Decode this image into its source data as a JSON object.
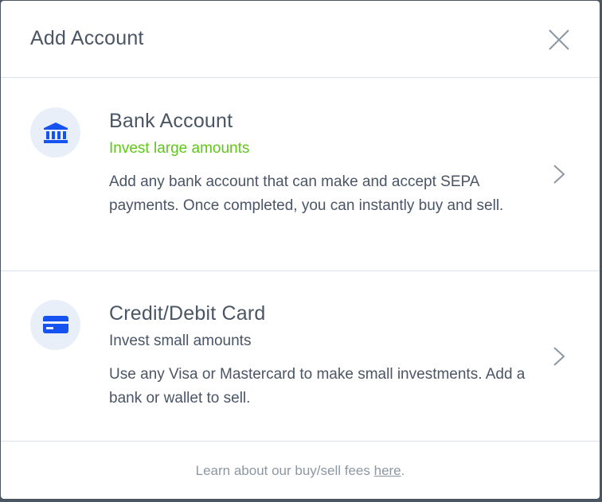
{
  "modal": {
    "title": "Add Account",
    "close_icon": "close-icon"
  },
  "options": [
    {
      "icon": "bank-icon",
      "title": "Bank Account",
      "subtitle": "Invest large amounts",
      "subtitle_color": "#5fc717",
      "description": "Add any bank account that can make and accept SEPA payments. Once completed, you can instantly buy and sell.",
      "chevron_icon": "chevron-right-icon"
    },
    {
      "icon": "credit-card-icon",
      "title": "Credit/Debit Card",
      "subtitle": "Invest small amounts",
      "description": "Use any Visa or Mastercard to make small investments. Add a bank or wallet to sell.",
      "chevron_icon": "chevron-right-icon"
    }
  ],
  "footer": {
    "text_before": "Learn about our buy/sell fees ",
    "link_text": "here",
    "text_after": "."
  },
  "colors": {
    "accent_blue": "#1652f0",
    "icon_bg": "#e8eff8",
    "green": "#5fc717",
    "text": "#4a5565",
    "muted": "#8c97a4",
    "divider": "#dae1e9"
  }
}
